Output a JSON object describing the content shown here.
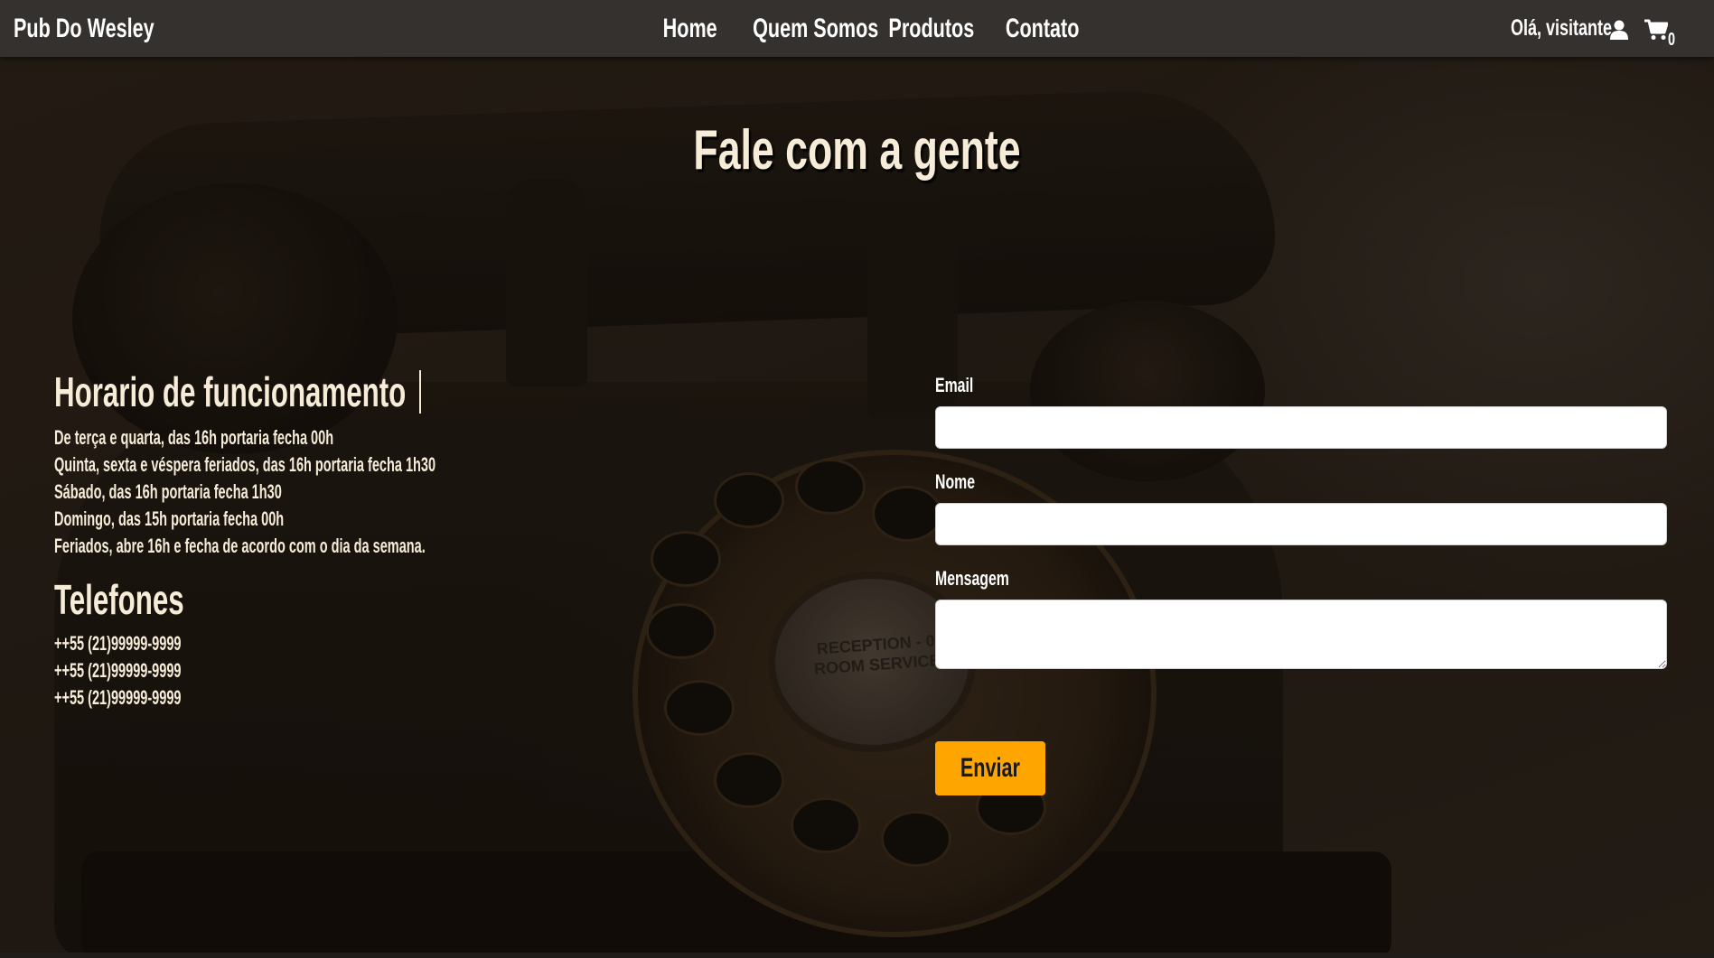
{
  "navbar": {
    "brand": "Pub Do Wesley",
    "links": [
      {
        "label": "Home"
      },
      {
        "label": "Quem Somos"
      },
      {
        "label": "Produtos"
      },
      {
        "label": "Contato"
      }
    ],
    "greeting": "Olá, visitante",
    "user_icon": "user-icon",
    "cart_icon": "cart-icon",
    "cart_count": "0"
  },
  "hero": {
    "background_subject": "rotary-telephone-photo",
    "dial_text_line1": "RECEPTION - 0",
    "dial_text_line2": "ROOM SERVICE"
  },
  "main": {
    "title": "Fale com a gente",
    "hours": {
      "heading": "Horario de funcionamento",
      "lines": [
        "De terça e quarta, das 16h portaria fecha 00h",
        "Quinta, sexta e véspera feriados, das 16h portaria fecha 1h30",
        "Sábado, das 16h portaria fecha 1h30",
        "Domingo, das 15h portaria fecha 00h",
        "Feriados, abre 16h e fecha de acordo com o dia da semana."
      ]
    },
    "phones": {
      "heading": "Telefones",
      "numbers": [
        "++55 (21)99999-9999",
        "++55 (21)99999-9999",
        "++55 (21)99999-9999"
      ]
    }
  },
  "form": {
    "email_label": "Email",
    "email_value": "",
    "name_label": "Nome",
    "name_value": "",
    "message_label": "Mensagem",
    "message_value": "",
    "submit_label": "Enviar"
  },
  "colors": {
    "navbar_bg": "#34312e",
    "text_cream": "#f6ecd8",
    "submit_button": "#ffa500"
  }
}
